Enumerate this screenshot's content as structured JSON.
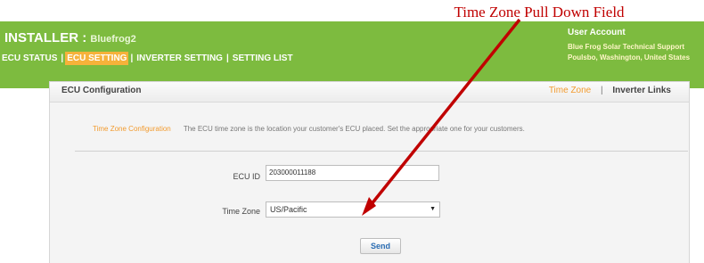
{
  "annotation": {
    "text": "Time Zone Pull Down Field"
  },
  "header": {
    "role": "INSTALLER",
    "separator": ":",
    "site_name": "Bluefrog2",
    "nav": {
      "ecu_status": "ECU STATUS",
      "divider": "|",
      "ecu_setting": "ECU SETTING",
      "inverter_setting": "INVERTER SETTING",
      "setting_list": "SETTING LIST"
    },
    "account": {
      "title": "User Account",
      "line1": "Blue Frog Solar Technical Support",
      "line2": "Poulsbo, Washington, United States"
    }
  },
  "panel": {
    "title": "ECU Configuration",
    "links": {
      "time_zone": "Time Zone",
      "divider": "|",
      "inverter_links": "Inverter Links"
    },
    "description_label": "Time Zone Configuration",
    "description_text": "The ECU time zone is the location your customer's ECU placed. Set the appropriate one for your customers.",
    "ecu_id_label": "ECU ID",
    "ecu_id_value": "203000011188",
    "time_zone_label": "Time Zone",
    "time_zone_value": "US/Pacific",
    "send_label": "Send"
  },
  "colors": {
    "brand_green": "#7dbb3f",
    "active_nav": "#f6b23a",
    "orange_text": "#f29b2f",
    "arrow_red": "#c00000",
    "send_blue": "#2b6db3"
  },
  "icons": {
    "select_caret": "dropdown-caret-icon",
    "arrow": "annotation-arrow"
  }
}
